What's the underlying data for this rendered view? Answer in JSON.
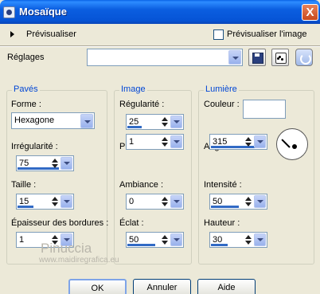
{
  "window": {
    "title": "Mosaïque",
    "close_label": "X",
    "title_icon": "app-icon"
  },
  "preview": {
    "expand_label": "Prévisualiser",
    "checkbox_label": "Prévisualiser l'image",
    "checked": false
  },
  "presets": {
    "label": "Réglages",
    "value": ""
  },
  "groups": {
    "tiles": {
      "legend": "Pavés",
      "shape_label": "Forme :",
      "shape_value": "Hexagone",
      "irregularity_label": "Irrégularité :",
      "irregularity_value": "75",
      "size_label": "Taille :",
      "size_value": "15",
      "border_label": "Épaisseur des bordures :",
      "border_value": "1"
    },
    "image": {
      "legend": "Image",
      "regularity_label": "Régularité :",
      "regularity_value": "25",
      "depth_label": "Profondeur :",
      "depth_value": "1",
      "ambiance_label": "Ambiance :",
      "ambiance_value": "0",
      "shine_label": "Éclat :",
      "shine_value": "50"
    },
    "light": {
      "legend": "Lumière",
      "color_label": "Couleur :",
      "color_value": "#ffffff",
      "angle_label": "Angle :",
      "angle_value": "315",
      "intensity_label": "Intensité :",
      "intensity_value": "50",
      "height_label": "Hauteur :",
      "height_value": "30"
    }
  },
  "watermark": {
    "line1": "Pinuccia",
    "line2": "www.maidiregrafica.eu"
  },
  "buttons": {
    "ok": "OK",
    "cancel": "Annuler",
    "help": "Aide"
  }
}
